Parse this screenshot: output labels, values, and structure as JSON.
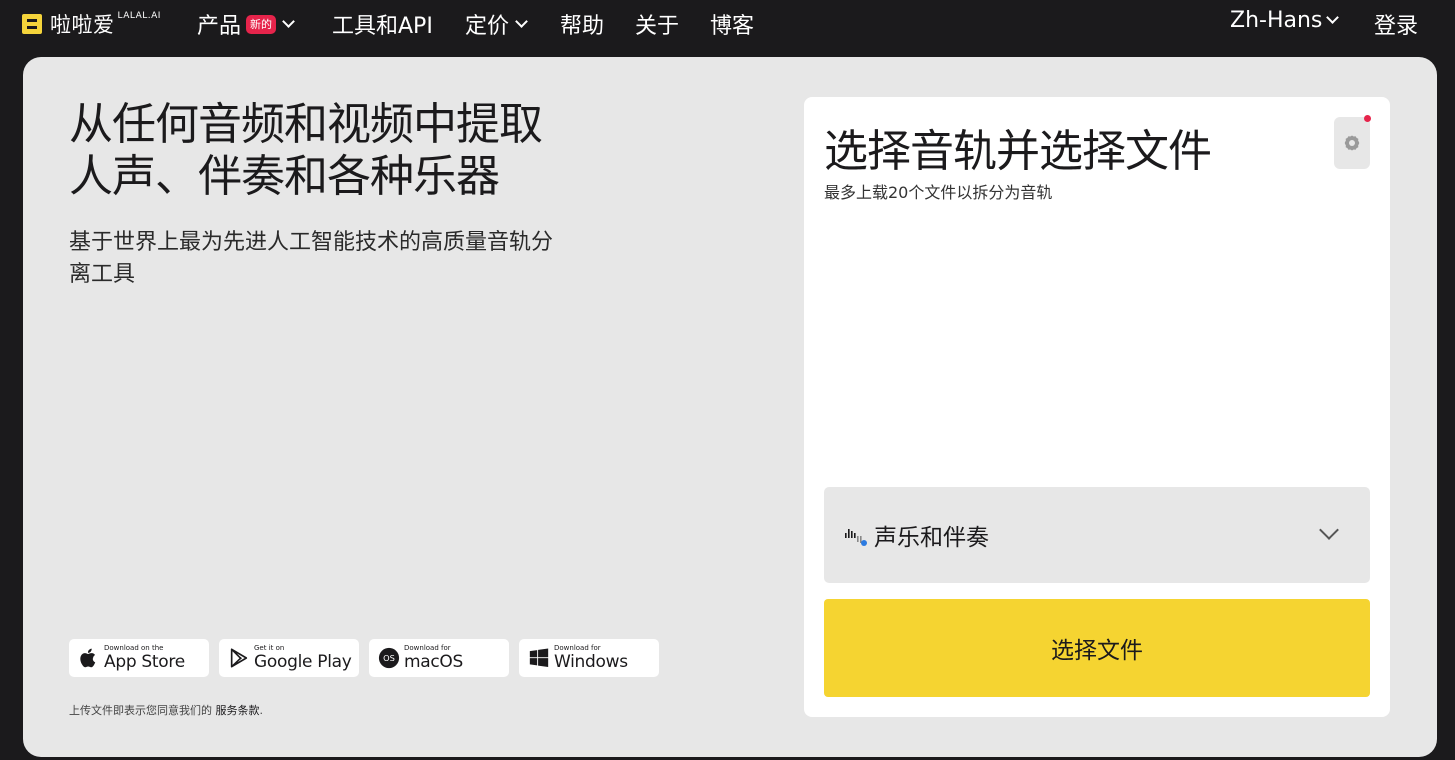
{
  "nav": {
    "logo_text": "啦啦爱",
    "logo_sup": "LALAL.AI",
    "products": "产品",
    "new_badge": "新的",
    "tools_api": "工具和API",
    "pricing": "定价",
    "help": "帮助",
    "about": "关于",
    "blog": "博客",
    "language": "Zh-Hans",
    "login": "登录"
  },
  "hero": {
    "title_line1": "从任何音频和视频中提取",
    "title_line2": "人声、伴奏和各种乐器",
    "subtitle": "基于世界上最为先进人工智能技术的高质量音轨分离工具"
  },
  "stores": [
    {
      "small": "Download on the",
      "big": "App Store",
      "icon": "apple-icon"
    },
    {
      "small": "Get it on",
      "big": "Google Play",
      "icon": "google-play-icon"
    },
    {
      "small": "Download for",
      "big": "macOS",
      "icon": "macos-icon"
    },
    {
      "small": "Download for",
      "big": "Windows",
      "icon": "windows-icon"
    }
  ],
  "terms": {
    "prefix": "上传文件即表示您同意我们的",
    "link": "服务条款",
    "suffix": "."
  },
  "upload": {
    "title": "选择音轨并选择文件",
    "subtitle": "最多上载20个文件以拆分为音轨",
    "stem_selected": "声乐和伴奏",
    "choose_button": "选择文件"
  },
  "colors": {
    "background": "#1b1a1c",
    "panel": "#e7e7e7",
    "accent_yellow": "#f5d431",
    "badge_red": "#e6244b"
  }
}
